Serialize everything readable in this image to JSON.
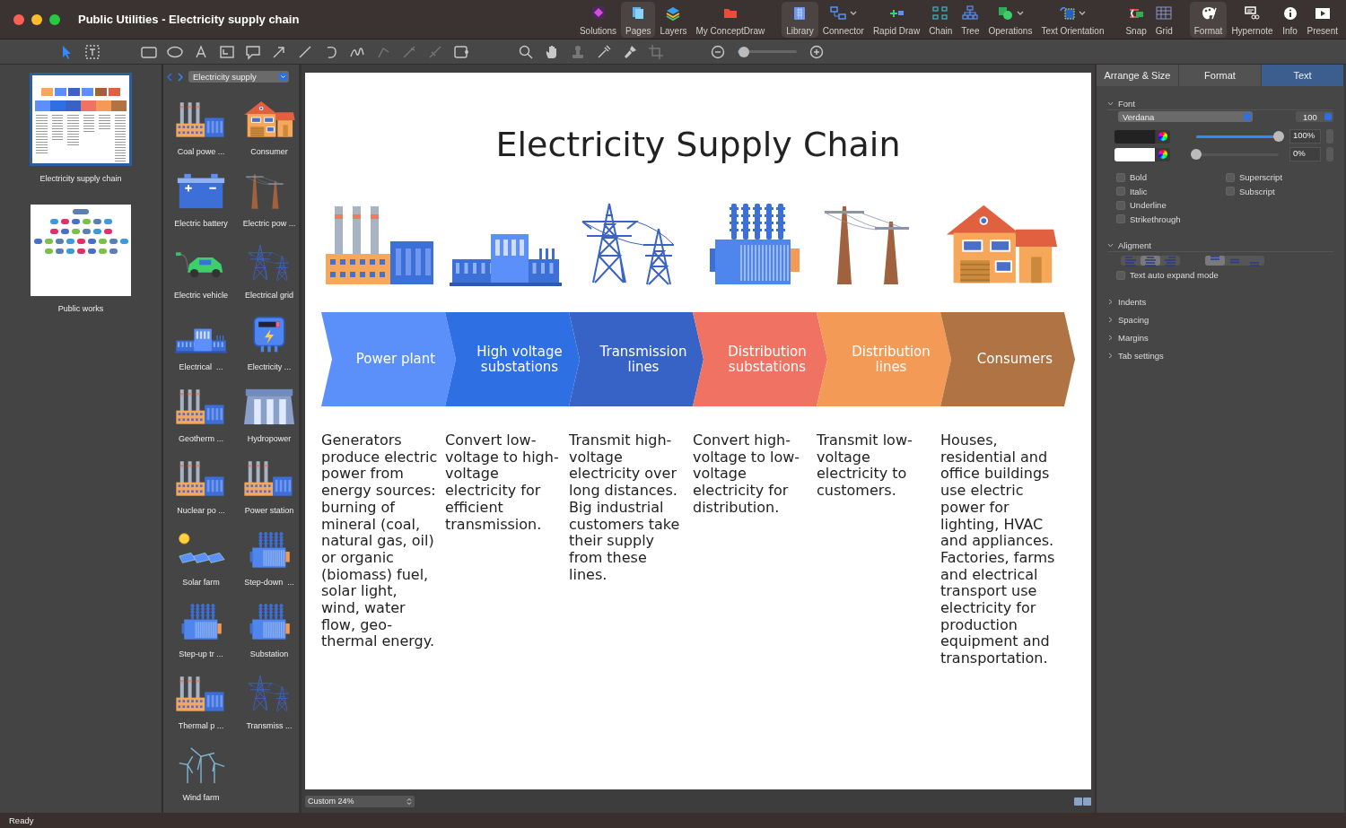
{
  "window": {
    "title": "Public Utilities - Electricity supply chain"
  },
  "toolbar": {
    "groups": [
      {
        "items": [
          {
            "label": "Solutions",
            "selected": false,
            "dropdown": false
          },
          {
            "label": "Pages",
            "selected": true,
            "dropdown": false
          },
          {
            "label": "Layers",
            "selected": false,
            "dropdown": false
          },
          {
            "label": "My ConceptDraw",
            "selected": false,
            "dropdown": false
          }
        ]
      },
      {
        "items": [
          {
            "label": "Library",
            "selected": true,
            "dropdown": false
          },
          {
            "label": "Connector",
            "selected": false,
            "dropdown": true
          },
          {
            "label": "Rapid Draw",
            "selected": false,
            "dropdown": false
          },
          {
            "label": "Chain",
            "selected": false,
            "dropdown": false
          },
          {
            "label": "Tree",
            "selected": false,
            "dropdown": false
          },
          {
            "label": "Operations",
            "selected": false,
            "dropdown": true
          },
          {
            "label": "Text Orientation",
            "selected": false,
            "dropdown": true
          }
        ]
      },
      {
        "items": [
          {
            "label": "Snap",
            "selected": false,
            "dropdown": false
          },
          {
            "label": "Grid",
            "selected": false,
            "dropdown": false
          }
        ]
      },
      {
        "items": [
          {
            "label": "Format",
            "selected": true,
            "dropdown": false
          },
          {
            "label": "Hypernote",
            "selected": false,
            "dropdown": false
          },
          {
            "label": "Info",
            "selected": false,
            "dropdown": false
          },
          {
            "label": "Present",
            "selected": false,
            "dropdown": false
          }
        ]
      }
    ]
  },
  "zoom_slider": {
    "level": 0.1
  },
  "pages": [
    {
      "label": "Electricity supply chain",
      "selected": true
    },
    {
      "label": "Public works",
      "selected": false
    }
  ],
  "library": {
    "category": "Electricity supply",
    "items": [
      {
        "label": "Coal powe ..."
      },
      {
        "label": "Consumer"
      },
      {
        "label": "Electric battery"
      },
      {
        "label": "Electric pow ..."
      },
      {
        "label": "Electric vehicle"
      },
      {
        "label": "Electrical grid"
      },
      {
        "label": "Electrical  ..."
      },
      {
        "label": "Electricity ..."
      },
      {
        "label": "Geotherm ..."
      },
      {
        "label": "Hydropower"
      },
      {
        "label": "Nuclear po ..."
      },
      {
        "label": "Power station"
      },
      {
        "label": "Solar farm"
      },
      {
        "label": "Step-down  ..."
      },
      {
        "label": "Step-up tr ..."
      },
      {
        "label": "Substation"
      },
      {
        "label": "Thermal p ..."
      },
      {
        "label": "Transmiss ..."
      },
      {
        "label": "Wind farm"
      }
    ]
  },
  "diagram": {
    "title": "Electricity Supply Chain",
    "stages": [
      {
        "label": "Power plant",
        "color": "#5b8ff9",
        "description": "Generators produce electric power from energy sources: burning of mineral (coal, natural gas, oil)\nor organic (biomass) fuel, solar light, wind, water flow, geo-thermal energy."
      },
      {
        "label": "High voltage substations",
        "color": "#2f6fe4",
        "description": "Convert low-voltage to high-voltage electricity for efficient transmission."
      },
      {
        "label": "Transmission lines",
        "color": "#3863c6",
        "description": "Transmit high-voltage electricity over long distances. Big industrial customers take their supply from these lines."
      },
      {
        "label": "Distribution substations",
        "color": "#ef7262",
        "description": "Convert high-voltage to low-voltage electricity for distribution."
      },
      {
        "label": "Distribution lines",
        "color": "#f29a56",
        "description": "Transmit low-voltage electricity to customers."
      },
      {
        "label": "Consumers",
        "color": "#b07444",
        "description": "Houses, residential and office buildings use electric power for lighting, HVAC and appliances. Factories, farms and electrical transport use electricity for production equipment and transportation."
      }
    ]
  },
  "zoom_select": {
    "value": "Custom 24%"
  },
  "properties": {
    "tabs": [
      {
        "label": "Arrange & Size",
        "selected": false
      },
      {
        "label": "Format",
        "selected": false
      },
      {
        "label": "Text",
        "selected": true
      }
    ],
    "font": {
      "label": "Font",
      "expanded": true,
      "family": "Verdana",
      "size": "100",
      "opacity": {
        "level": 1,
        "reading": "100%"
      },
      "background_opacity": {
        "level": 0,
        "reading": "0%"
      },
      "styles": [
        {
          "label": "Bold",
          "checked": false
        },
        {
          "label": "Italic",
          "checked": false
        },
        {
          "label": "Underline",
          "checked": false
        },
        {
          "label": "Strikethrough",
          "checked": false
        },
        {
          "label": "Superscript",
          "checked": false
        },
        {
          "label": "Subscript",
          "checked": false
        }
      ]
    },
    "alignment": {
      "label": "Aligment",
      "expanded": true,
      "horizontal": [
        {
          "selected": false
        },
        {
          "selected": true
        },
        {
          "selected": false
        }
      ],
      "vertical": [
        {
          "selected": true
        },
        {
          "selected": false
        },
        {
          "selected": false
        }
      ],
      "auto_expand": {
        "label": "Text auto expand mode",
        "checked": false
      }
    },
    "sections": [
      {
        "label": "Indents",
        "expanded": false
      },
      {
        "label": "Spacing",
        "expanded": false
      },
      {
        "label": "Margins",
        "expanded": false
      },
      {
        "label": "Tab settings",
        "expanded": false
      }
    ]
  },
  "status_bar": {
    "text": "Ready"
  }
}
